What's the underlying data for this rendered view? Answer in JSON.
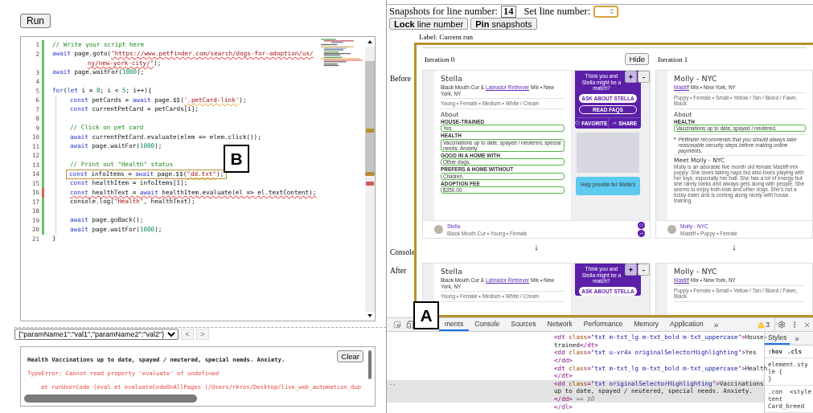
{
  "editor_panel": {
    "run_button": "Run",
    "callout": "B",
    "code_lines": [
      {
        "number": "1",
        "changed": true,
        "error": false,
        "boxed": false,
        "tokens": [
          {
            "kind": "com",
            "text": "// Write your script here"
          }
        ]
      },
      {
        "number": "2",
        "changed": true,
        "error": false,
        "boxed": false,
        "tokens": [
          {
            "kind": "kw",
            "text": "await"
          },
          {
            "kind": "txt",
            "text": " page.goto("
          },
          {
            "kind": "str",
            "text": "\"https://www.petfinder.com/search/dogs-for-adoption/us/",
            "error": true
          }
        ],
        "continuation": [
          {
            "kind": "str",
            "text": "ny/new-york-city/\"",
            "error": true
          },
          {
            "kind": "txt",
            "text": ");"
          }
        ]
      },
      {
        "number": "3",
        "changed": true,
        "error": false,
        "boxed": false,
        "tokens": [
          {
            "kind": "kw",
            "text": "await"
          },
          {
            "kind": "txt",
            "text": " page.waitFor("
          },
          {
            "kind": "num",
            "text": "1000"
          },
          {
            "kind": "txt",
            "text": ");"
          }
        ]
      },
      {
        "number": "4",
        "changed": true,
        "error": false,
        "boxed": false
      },
      {
        "number": "5",
        "changed": true,
        "error": false,
        "boxed": false,
        "tokens": [
          {
            "kind": "kw",
            "text": "for"
          },
          {
            "kind": "txt",
            "text": "("
          },
          {
            "kind": "kw",
            "text": "let"
          },
          {
            "kind": "txt",
            "text": " i = "
          },
          {
            "kind": "num",
            "text": "0"
          },
          {
            "kind": "txt",
            "text": "; i < "
          },
          {
            "kind": "num",
            "text": "5"
          },
          {
            "kind": "txt",
            "text": "; i++){"
          }
        ],
        "children": [
          {
            "number": "6",
            "changed": true,
            "error": false,
            "boxed": false,
            "tokens": [
              {
                "kind": "kw",
                "text": "const"
              },
              {
                "kind": "txt",
                "text": " petCards = "
              },
              {
                "kind": "kw",
                "text": "await"
              },
              {
                "kind": "txt",
                "text": " page.$$("
              },
              {
                "kind": "str",
                "text": "'.petCard-link'",
                "warning": true
              },
              {
                "kind": "txt",
                "text": ");"
              }
            ]
          },
          {
            "number": "7",
            "changed": true,
            "error": false,
            "boxed": false,
            "tokens": [
              {
                "kind": "kw",
                "text": "const"
              },
              {
                "kind": "txt",
                "text": " currentPetCard = petCards[i];"
              }
            ]
          },
          {
            "number": "8",
            "changed": true,
            "error": false,
            "boxed": false
          },
          {
            "number": "9",
            "changed": true,
            "error": false,
            "boxed": false,
            "tokens": [
              {
                "kind": "com",
                "text": "// Click on pet card"
              }
            ]
          },
          {
            "number": "10",
            "changed": true,
            "error": false,
            "boxed": false,
            "tokens": [
              {
                "kind": "kw",
                "text": "await"
              },
              {
                "kind": "txt",
                "text": " currentPetCard.evaluate(elem => elem.click());"
              }
            ]
          },
          {
            "number": "11",
            "changed": true,
            "error": false,
            "boxed": false,
            "tokens": [
              {
                "kind": "kw",
                "text": "await"
              },
              {
                "kind": "txt",
                "text": " page.waitFor("
              },
              {
                "kind": "num",
                "text": "1000"
              },
              {
                "kind": "txt",
                "text": ");"
              }
            ]
          },
          {
            "number": "12",
            "changed": true,
            "error": false,
            "boxed": false
          },
          {
            "number": "13",
            "changed": true,
            "error": false,
            "boxed": false,
            "tokens": [
              {
                "kind": "com",
                "text": "// Print out \"Health\" status"
              }
            ]
          },
          {
            "number": "14",
            "changed": true,
            "error": false,
            "boxed": true,
            "tokens": [
              {
                "kind": "kw",
                "text": "const"
              },
              {
                "kind": "txt",
                "text": " infoItems = "
              },
              {
                "kind": "kw",
                "text": "await"
              },
              {
                "kind": "txt",
                "text": " page.$$("
              },
              {
                "kind": "str",
                "text": "\"dd.txt\"",
                "warning": true
              },
              {
                "kind": "txt",
                "text": ");"
              }
            ]
          },
          {
            "number": "15",
            "changed": true,
            "error": false,
            "boxed": false,
            "tokens": [
              {
                "kind": "kw",
                "text": "const"
              },
              {
                "kind": "txt",
                "text": " healthItem = infoItems[1];"
              }
            ]
          },
          {
            "number": "16",
            "changed": true,
            "error": true,
            "boxed": false,
            "tokens": [
              {
                "kind": "kw",
                "text": "const",
                "error": true
              },
              {
                "kind": "txt",
                "text": " healthText = ",
                "error": true
              },
              {
                "kind": "kw",
                "text": "await",
                "error": true
              },
              {
                "kind": "txt",
                "text": " healthItem.evaluate(el => el.textContent);",
                "error": true
              }
            ]
          },
          {
            "number": "17",
            "changed": true,
            "error": false,
            "boxed": false,
            "tokens": [
              {
                "kind": "txt",
                "text": "console.log("
              },
              {
                "kind": "str",
                "text": "\"Health\""
              },
              {
                "kind": "txt",
                "text": ", healthText);"
              }
            ]
          },
          {
            "number": "18",
            "changed": true,
            "error": false,
            "boxed": false
          },
          {
            "number": "19",
            "changed": true,
            "error": false,
            "boxed": false,
            "tokens": [
              {
                "kind": "kw",
                "text": "await"
              },
              {
                "kind": "txt",
                "text": " page.goBack();"
              }
            ]
          },
          {
            "number": "20",
            "changed": true,
            "error": false,
            "boxed": false,
            "tokens": [
              {
                "kind": "kw",
                "text": "await"
              },
              {
                "kind": "txt",
                "text": " page.waitFor("
              },
              {
                "kind": "num",
                "text": "1000"
              },
              {
                "kind": "txt",
                "text": ");"
              }
            ]
          }
        ]
      },
      {
        "number": "21",
        "changed": false,
        "error": false,
        "boxed": false,
        "tokens": [
          {
            "kind": "txt",
            "text": "}"
          }
        ]
      }
    ],
    "params_select": "{\"paramName1\":\"val1\",\"paramName2\":\"val2\"}",
    "nav_buttons": [
      {
        "text": "<",
        "disabled": true
      },
      {
        "text": ">",
        "disabled": true
      }
    ],
    "console": {
      "clear_button": "Clear",
      "lines": [
        {
          "kind": "log",
          "text": "Health Vaccinations up to date, spayed / neutered, special needs. Anxiety."
        },
        {
          "kind": "error",
          "text": "TypeError: Cannot read property 'evaluate' of undefined"
        },
        {
          "kind": "trace",
          "text": "at runUserCode (eval at evaluateCodeOnAllPages (/Users/rkros/Desktop/live_web_automation_dup"
        }
      ]
    }
  },
  "snapshot_panel": {
    "line_label": "Snapshots for line number:",
    "line_number": "14",
    "set_label": "Set line number:",
    "buttons": [
      "**Lock** line number",
      "**Pin** snapshots"
    ],
    "run_label": "Label: Current run",
    "row_labels": [
      "Before",
      "Console",
      "After"
    ],
    "iterations": [
      {
        "label": "Iteration 0",
        "hide_button": "Hide",
        "arrow": "↓",
        "before": {
          "zoom_buttons": [
            "+",
            "-"
          ],
          "name": "Stella",
          "breed": [
            {
              "text": "Black Mouth Cur &",
              "link": false
            },
            {
              "text": "Labrador Retriever",
              "link": true
            },
            {
              "text": "Mix • New York, NY",
              "link": false
            }
          ],
          "traits": "Young • Female • Medium • White / Cream",
          "about": "About",
          "fields": [
            {
              "label": "HOUSE-TRAINED",
              "value": "Yes"
            },
            {
              "label": "HEALTH",
              "value": "Vaccinations up to date, spayed / neutered, special needs. Anxiety."
            },
            {
              "label": "GOOD IN A HOME WITH",
              "value": "Other dogs."
            },
            {
              "label": "PREFERS A HOME WITHOUT",
              "value": "Children."
            },
            {
              "label": "ADOPTION FEE",
              "value": "$350.00"
            }
          ],
          "sidebar": {
            "prompt": "Think you and Stella might be a match?",
            "ask": "ASK ABOUT STELLA",
            "faqs": "READ FAQS",
            "favorite": "FAVORITE",
            "share": "SHARE",
            "help": "Help provide for Stella's"
          },
          "footer": {
            "name": "Stella",
            "meta": "Black Mouth Cur • Young • Female"
          }
        },
        "after": {
          "zoom_buttons": [
            "+",
            "-"
          ],
          "name": "Stella",
          "breed": [
            {
              "text": "Black Mouth Cur &",
              "link": false
            },
            {
              "text": "Labrador Retriever",
              "link": true
            },
            {
              "text": "Mix • New York, NY",
              "link": false
            }
          ],
          "traits": "Young • Female • Medium • White / Cream",
          "sidebar": {
            "prompt": "Think you and Stella might be a match?",
            "ask": "ASK ABOUT STELLA"
          }
        }
      },
      {
        "label": "Iteration 1",
        "arrow": "↓",
        "before": {
          "name": "Molly - NYC",
          "breed": [
            {
              "text": "Mastiff",
              "link": true
            },
            {
              "text": "Mix • New York, NY",
              "link": false
            }
          ],
          "traits": "Puppy • Female • Small • Yellow / Tan / Blond / Fawn, Black",
          "about": "About",
          "fields": [
            {
              "label": "HEALTH",
              "value": "Vaccinations up to date, spayed / neutered."
            }
          ],
          "notice": "Petfinder recommends that you should always take reasonable security steps before making online payments.",
          "meet_title": "Meet Molly - NYC",
          "story": "Molly is an adorable five month old female Mastiff mix puppy. She loves taking naps but also loves playing with her toys, especially her ball. She has a lot of energy but she rarely barks and always gets along with people. She seems to enjoy both kids and other dogs. She's not a fussy eater and is coming along nicely with house training.",
          "footer": {
            "name": "Molly - NYC",
            "meta": "Mastiff • Puppy • Female"
          }
        },
        "after": {
          "name": "Molly - NYC",
          "breed": [
            {
              "text": "Mastiff",
              "link": true
            },
            {
              "text": "Mix • New York, NY",
              "link": false
            }
          ],
          "traits": "Puppy • Female • Small • Yellow / Tan / Blond / Fawn, Black"
        }
      }
    ]
  },
  "devtools": {
    "callout": "A",
    "tabs": [
      {
        "label": "ments",
        "selected": true
      },
      {
        "label": "Console",
        "selected": false
      },
      {
        "label": "Sources",
        "selected": false
      },
      {
        "label": "Network",
        "selected": false
      },
      {
        "label": "Performance",
        "selected": false
      },
      {
        "label": "Memory",
        "selected": false
      },
      {
        "label": "Application",
        "selected": false
      }
    ],
    "more_tabs": "»",
    "warning_count": "3",
    "dom_rows": [
      {
        "selected": false,
        "segments": [
          {
            "kind": "tag",
            "text": "<dt "
          },
          {
            "kind": "attr",
            "text": "class"
          },
          {
            "kind": "tag",
            "text": "=\""
          },
          {
            "kind": "val",
            "text": "txt m-txt_lg m-txt_bold m-txt_uppercase"
          },
          {
            "kind": "tag",
            "text": "\">"
          },
          {
            "kind": "text",
            "text": "House-"
          }
        ]
      },
      {
        "selected": false,
        "segments": [
          {
            "kind": "text",
            "text": "trained"
          },
          {
            "kind": "tag",
            "text": "</dt>"
          }
        ]
      },
      {
        "selected": false,
        "segments": [
          {
            "kind": "tag",
            "text": "<dd "
          },
          {
            "kind": "attr",
            "text": "class"
          },
          {
            "kind": "tag",
            "text": "=\""
          },
          {
            "kind": "val",
            "text": "txt u-vr4x originalSelectorHighlighting"
          },
          {
            "kind": "tag",
            "text": "\">"
          },
          {
            "kind": "text",
            "text": "Yes"
          }
        ]
      },
      {
        "selected": false,
        "segments": [
          {
            "kind": "tag",
            "text": "</dd>"
          }
        ]
      },
      {
        "selected": false,
        "segments": [
          {
            "kind": "tag",
            "text": "<dt "
          },
          {
            "kind": "attr",
            "text": "class"
          },
          {
            "kind": "tag",
            "text": "=\""
          },
          {
            "kind": "val",
            "text": "txt m-txt_lg m-txt_bold m-txt_uppercase"
          },
          {
            "kind": "tag",
            "text": "\">"
          },
          {
            "kind": "text",
            "text": "Health"
          }
        ]
      },
      {
        "selected": false,
        "segments": [
          {
            "kind": "tag",
            "text": "</dt>"
          }
        ]
      },
      {
        "selected": true,
        "marker": "..",
        "segments": [
          {
            "kind": "tag",
            "text": "<dd "
          },
          {
            "kind": "attr",
            "text": "class"
          },
          {
            "kind": "tag",
            "text": "=\""
          },
          {
            "kind": "val",
            "text": "txt originalSelectorHighlighting"
          },
          {
            "kind": "tag",
            "text": "\">"
          },
          {
            "kind": "text",
            "text": "Vaccinations"
          }
        ]
      },
      {
        "selected": true,
        "segments": [
          {
            "kind": "text",
            "text": "up to date, spayed / neutered, special needs. Anxiety."
          }
        ]
      },
      {
        "selected": true,
        "segments": [
          {
            "kind": "tag",
            "text": "</dd>"
          },
          {
            "kind": "dim",
            "text": " == $0"
          }
        ]
      },
      {
        "selected": false,
        "segments": [
          {
            "kind": "tag",
            "text": "</dl>"
          }
        ]
      }
    ],
    "styles_tab": "Styles",
    "styles_more": "»",
    "filters": [
      ":hov",
      ".cls"
    ],
    "style_blocks": [
      {
        "lines": [
          "element.sty",
          "le {",
          "}"
        ]
      },
      {
        "lines": [
          ".con",
          "tent",
          "Card_breed"
        ],
        "source": "<style"
      }
    ]
  }
}
